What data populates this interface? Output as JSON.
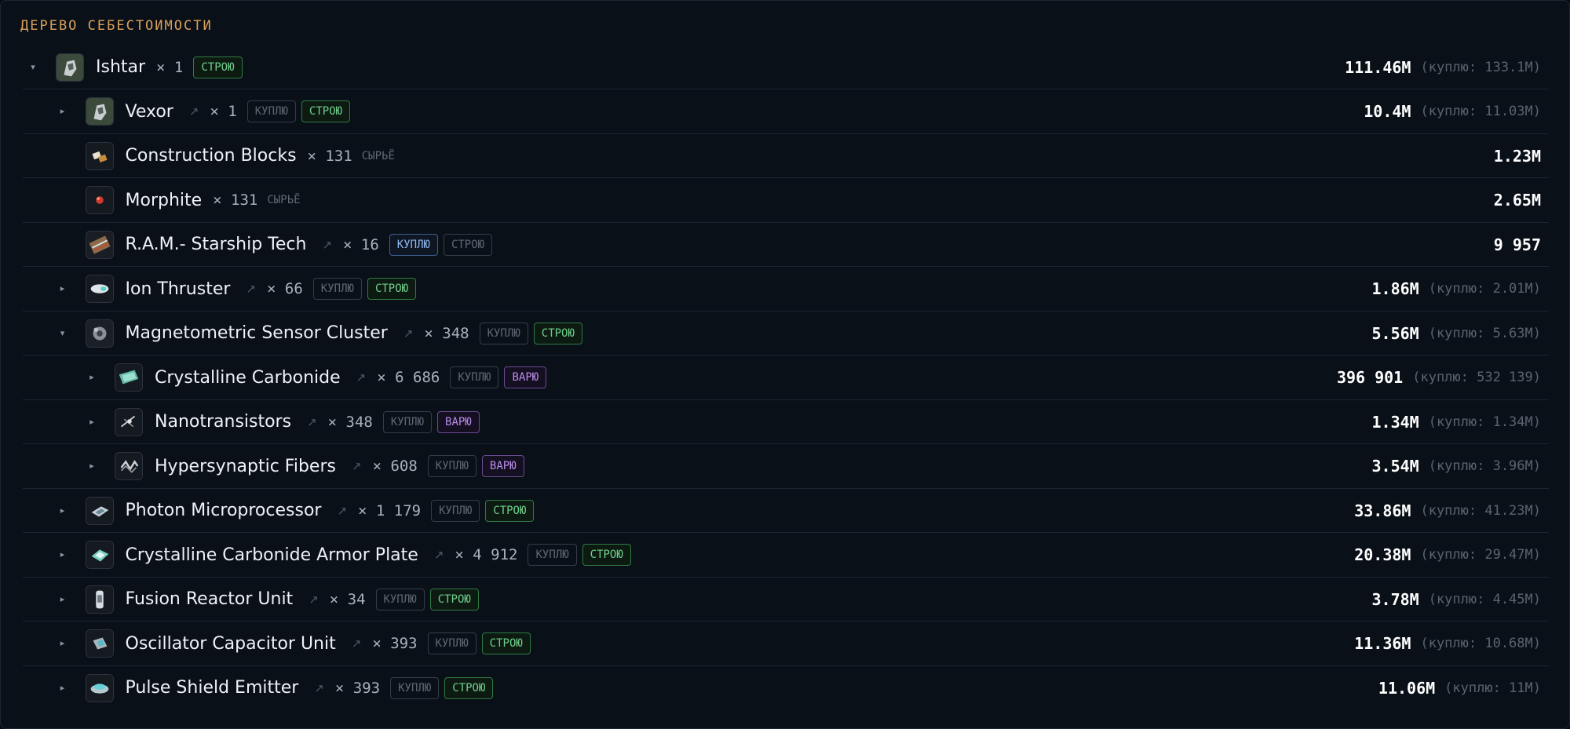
{
  "title": "ДЕРЕВО СЕБЕСТОИМОСТИ",
  "colors": {
    "build": "#6fd08c",
    "buy": "#8db6ec",
    "react": "#b98ce8",
    "accent": "#d9a05b"
  },
  "labels": {
    "raw": "СЫРЬЁ",
    "buy": "КУПЛЮ",
    "build": "СТРОЮ",
    "react": "ВАРЮ"
  },
  "rows": [
    {
      "depth": 0,
      "toggle": "▾",
      "icon": "ship-icon",
      "name": "Ishtar",
      "qty": "× 1",
      "link": "",
      "mode": "build-only",
      "cost": "111.46M",
      "buy_price": "(куплю: 133.1M)"
    },
    {
      "depth": 1,
      "toggle": "▸",
      "icon": "ship-icon",
      "name": "Vexor",
      "qty": "× 1",
      "link": "↗",
      "mode": "build",
      "cost": "10.4M",
      "buy_price": "(куплю: 11.03M)"
    },
    {
      "depth": 1,
      "toggle": "",
      "icon": "block-icon",
      "name": "Construction Blocks",
      "qty": "× 131",
      "link": "",
      "mode": "raw",
      "cost": "1.23M",
      "buy_price": ""
    },
    {
      "depth": 1,
      "toggle": "",
      "icon": "mineral-icon",
      "name": "Morphite",
      "qty": "× 131",
      "link": "",
      "mode": "raw",
      "cost": "2.65M",
      "buy_price": ""
    },
    {
      "depth": 1,
      "toggle": "",
      "icon": "datacore-icon",
      "name": "R.A.M.- Starship Tech",
      "qty": "× 16",
      "link": "↗",
      "mode": "buy",
      "cost": "9 957",
      "buy_price": ""
    },
    {
      "depth": 1,
      "toggle": "▸",
      "icon": "thruster-icon",
      "name": "Ion Thruster",
      "qty": "× 66",
      "link": "↗",
      "mode": "build",
      "cost": "1.86M",
      "buy_price": "(куплю: 2.01M)"
    },
    {
      "depth": 1,
      "toggle": "▾",
      "icon": "sensor-icon",
      "name": "Magnetometric Sensor Cluster",
      "qty": "× 348",
      "link": "↗",
      "mode": "build",
      "cost": "5.56M",
      "buy_price": "(куплю: 5.63M)"
    },
    {
      "depth": 2,
      "toggle": "▸",
      "icon": "plate-icon",
      "name": "Crystalline Carbonide",
      "qty": "× 6 686",
      "link": "↗",
      "mode": "react",
      "cost": "396 901",
      "buy_price": "(куплю: 532 139)"
    },
    {
      "depth": 2,
      "toggle": "▸",
      "icon": "transistor-icon",
      "name": "Nanotransistors",
      "qty": "× 348",
      "link": "↗",
      "mode": "react",
      "cost": "1.34M",
      "buy_price": "(куплю: 1.34M)"
    },
    {
      "depth": 2,
      "toggle": "▸",
      "icon": "fiber-icon",
      "name": "Hypersynaptic Fibers",
      "qty": "× 608",
      "link": "↗",
      "mode": "react",
      "cost": "3.54M",
      "buy_price": "(куплю: 3.96M)"
    },
    {
      "depth": 1,
      "toggle": "▸",
      "icon": "processor-icon",
      "name": "Photon Microprocessor",
      "qty": "× 1 179",
      "link": "↗",
      "mode": "build",
      "cost": "33.86M",
      "buy_price": "(куплю: 41.23M)"
    },
    {
      "depth": 1,
      "toggle": "▸",
      "icon": "armor-plate-icon",
      "name": "Crystalline Carbonide Armor Plate",
      "qty": "× 4 912",
      "link": "↗",
      "mode": "build",
      "cost": "20.38M",
      "buy_price": "(куплю: 29.47M)"
    },
    {
      "depth": 1,
      "toggle": "▸",
      "icon": "reactor-icon",
      "name": "Fusion Reactor Unit",
      "qty": "× 34",
      "link": "↗",
      "mode": "build",
      "cost": "3.78M",
      "buy_price": "(куплю: 4.45M)"
    },
    {
      "depth": 1,
      "toggle": "▸",
      "icon": "capacitor-icon",
      "name": "Oscillator Capacitor Unit",
      "qty": "× 393",
      "link": "↗",
      "mode": "build",
      "cost": "11.36M",
      "buy_price": "(куплю: 10.68M)"
    },
    {
      "depth": 1,
      "toggle": "▸",
      "icon": "emitter-icon",
      "name": "Pulse Shield Emitter",
      "qty": "× 393",
      "link": "↗",
      "mode": "build",
      "cost": "11.06M",
      "buy_price": "(куплю: 11M)"
    }
  ]
}
